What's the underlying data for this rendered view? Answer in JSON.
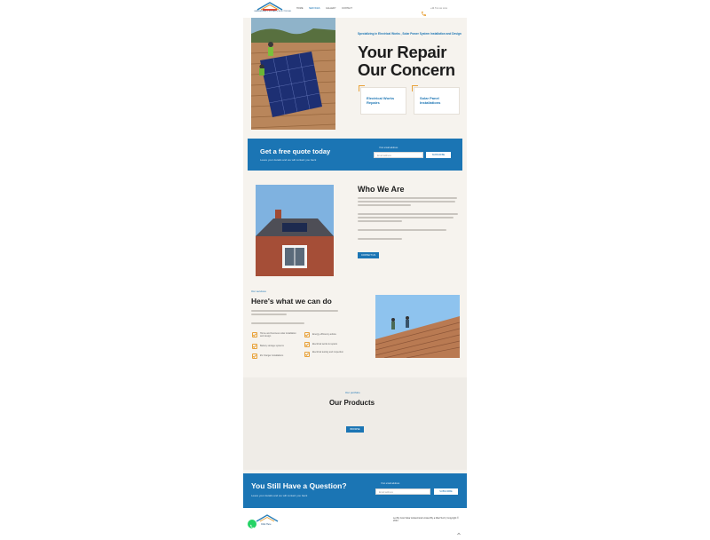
{
  "header": {
    "logo_text": "CAMBERWELL SOLAR & ELECTRICAL",
    "nav": [
      "HOME",
      "SERVICES",
      "GALLERY",
      "CONTACT"
    ],
    "phone": "+44 7xx xxx xxxx"
  },
  "hero": {
    "kicker": "Specializing in Electrical Works , Solar Power System Installation and Design",
    "title_line1": "Your Repair",
    "title_line2": "Our Concern",
    "cards": [
      {
        "label": "Electrical Works Repairs"
      },
      {
        "label": "Solar Panel Installations"
      }
    ]
  },
  "quote": {
    "title": "Get a free quote today",
    "subtitle": "Leave your details and we will contact you back",
    "email_label": "Your email address",
    "placeholder": "Email address",
    "button": "SUBSCRIBE"
  },
  "about": {
    "title": "Who We Are",
    "button": "CONTACT US"
  },
  "services": {
    "kicker": "Our services",
    "title": "Here's what we can do",
    "items_left": [
      "Home and business solar installation and design",
      "Battery storage systems",
      "EV charger installations"
    ],
    "items_right": [
      "Energy efficiency advice",
      "Electrical works & repairs",
      "Electrical testing and inspection"
    ]
  },
  "products": {
    "kicker": "Our portfolio",
    "title": "Our Products",
    "button": "BROWSE"
  },
  "question": {
    "title": "You Still Have a Question?",
    "subtitle": "Leave your details and we will contact you back",
    "email_label": "Your email address",
    "placeholder": "Email address",
    "button": "SUBSCRIBE"
  },
  "footer": {
    "logo_text": "Click Here",
    "copy": "Let By Cost Solar & Electrical Limited By a Mad Tech | Copyright © 2024"
  },
  "colors": {
    "brand_blue": "#1b75b4",
    "accent_orange": "#e8a23a",
    "page_bg": "#f6f3ee",
    "whatsapp": "#25d366"
  }
}
